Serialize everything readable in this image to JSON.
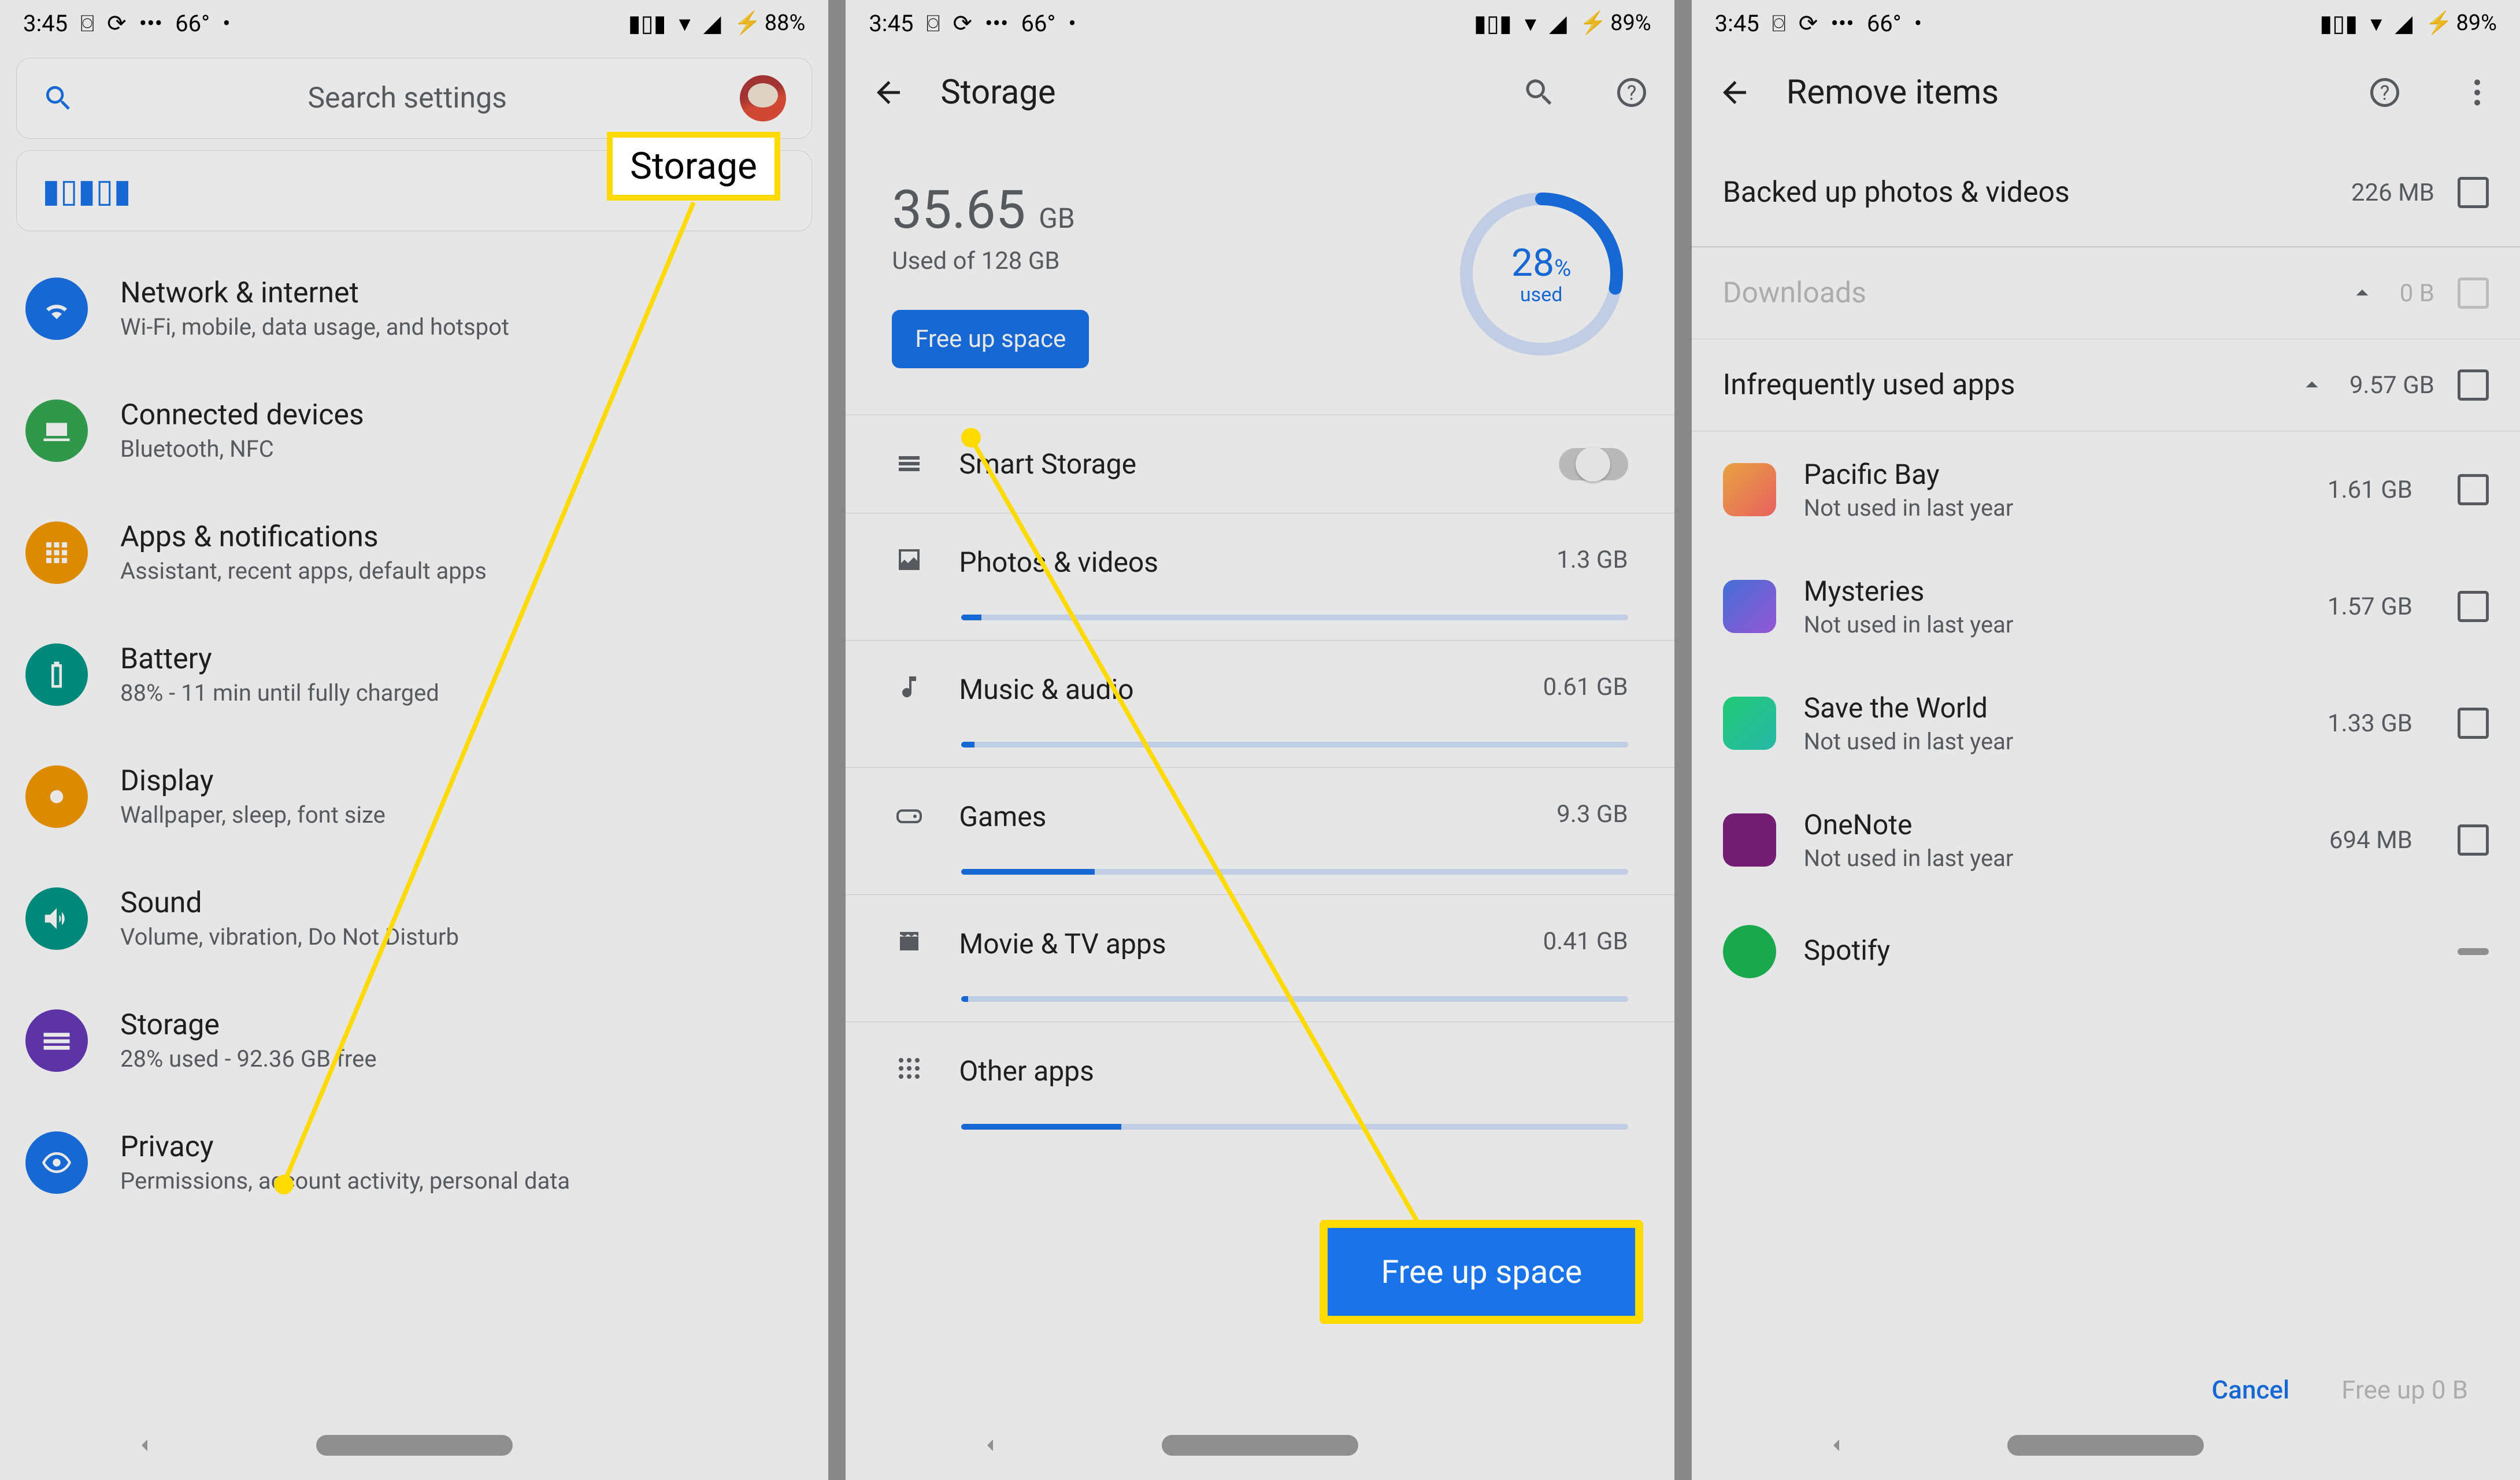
{
  "status": {
    "time": "3:45",
    "temp": "66°",
    "battery1": "88%",
    "battery2": "89%",
    "battery3": "89%"
  },
  "s1": {
    "search_placeholder": "Search settings",
    "items": [
      {
        "title": "Network & internet",
        "sub": "Wi-Fi, mobile, data usage, and hotspot",
        "color": "#1a73e8",
        "icon": "wifi"
      },
      {
        "title": "Connected devices",
        "sub": "Bluetooth, NFC",
        "color": "#34a853",
        "icon": "devices"
      },
      {
        "title": "Apps & notifications",
        "sub": "Assistant, recent apps, default apps",
        "color": "#f29900",
        "icon": "apps"
      },
      {
        "title": "Battery",
        "sub": "88% - 11 min until fully charged",
        "color": "#009688",
        "icon": "battery"
      },
      {
        "title": "Display",
        "sub": "Wallpaper, sleep, font size",
        "color": "#f29900",
        "icon": "brightness"
      },
      {
        "title": "Sound",
        "sub": "Volume, vibration, Do Not Disturb",
        "color": "#009688",
        "icon": "volume"
      },
      {
        "title": "Storage",
        "sub": "28% used - 92.36 GB free",
        "color": "#673ab7",
        "icon": "storage"
      },
      {
        "title": "Privacy",
        "sub": "Permissions, account activity, personal data",
        "color": "#1a73e8",
        "icon": "privacy"
      }
    ]
  },
  "s2": {
    "title": "Storage",
    "used_num": "35.65",
    "used_unit": "GB",
    "of": "Used of 128 GB",
    "free_btn": "Free up space",
    "pct": "28",
    "pct_sym": "%",
    "pct_label": "used",
    "rows": [
      {
        "label": "Smart Storage",
        "icon": "smart",
        "switch": true
      },
      {
        "label": "Photos & videos",
        "val": "1.3 GB",
        "icon": "photo",
        "bar": 3
      },
      {
        "label": "Music & audio",
        "val": "0.61 GB",
        "icon": "music",
        "bar": 2
      },
      {
        "label": "Games",
        "val": "9.3 GB",
        "icon": "game",
        "bar": 20
      },
      {
        "label": "Movie & TV apps",
        "val": "0.41 GB",
        "icon": "movie",
        "bar": 1
      },
      {
        "label": "Other apps",
        "val": "",
        "icon": "other",
        "bar": 24
      }
    ],
    "big_btn": "Free up space"
  },
  "s3": {
    "title": "Remove items",
    "sections": [
      {
        "label": "Backed up photos & videos",
        "val": "226 MB"
      },
      {
        "label": "Downloads",
        "val": "0 B",
        "dim": true
      },
      {
        "label": "Infrequently used apps",
        "val": "9.57 GB"
      }
    ],
    "apps": [
      {
        "name": "Pacific Bay",
        "sub": "Not used in last year",
        "size": "1.61 GB",
        "ic": "a"
      },
      {
        "name": "Mysteries",
        "sub": "Not used in last year",
        "size": "1.57 GB",
        "ic": "b"
      },
      {
        "name": "Save the World",
        "sub": "Not used in last year",
        "size": "1.33 GB",
        "ic": "c"
      },
      {
        "name": "OneNote",
        "sub": "Not used in last year",
        "size": "694 MB",
        "ic": "d"
      },
      {
        "name": "Spotify",
        "sub": "",
        "size": "",
        "ic": "e"
      }
    ],
    "cancel": "Cancel",
    "freeup": "Free up 0 B"
  },
  "callout": {
    "tag": "Storage"
  }
}
